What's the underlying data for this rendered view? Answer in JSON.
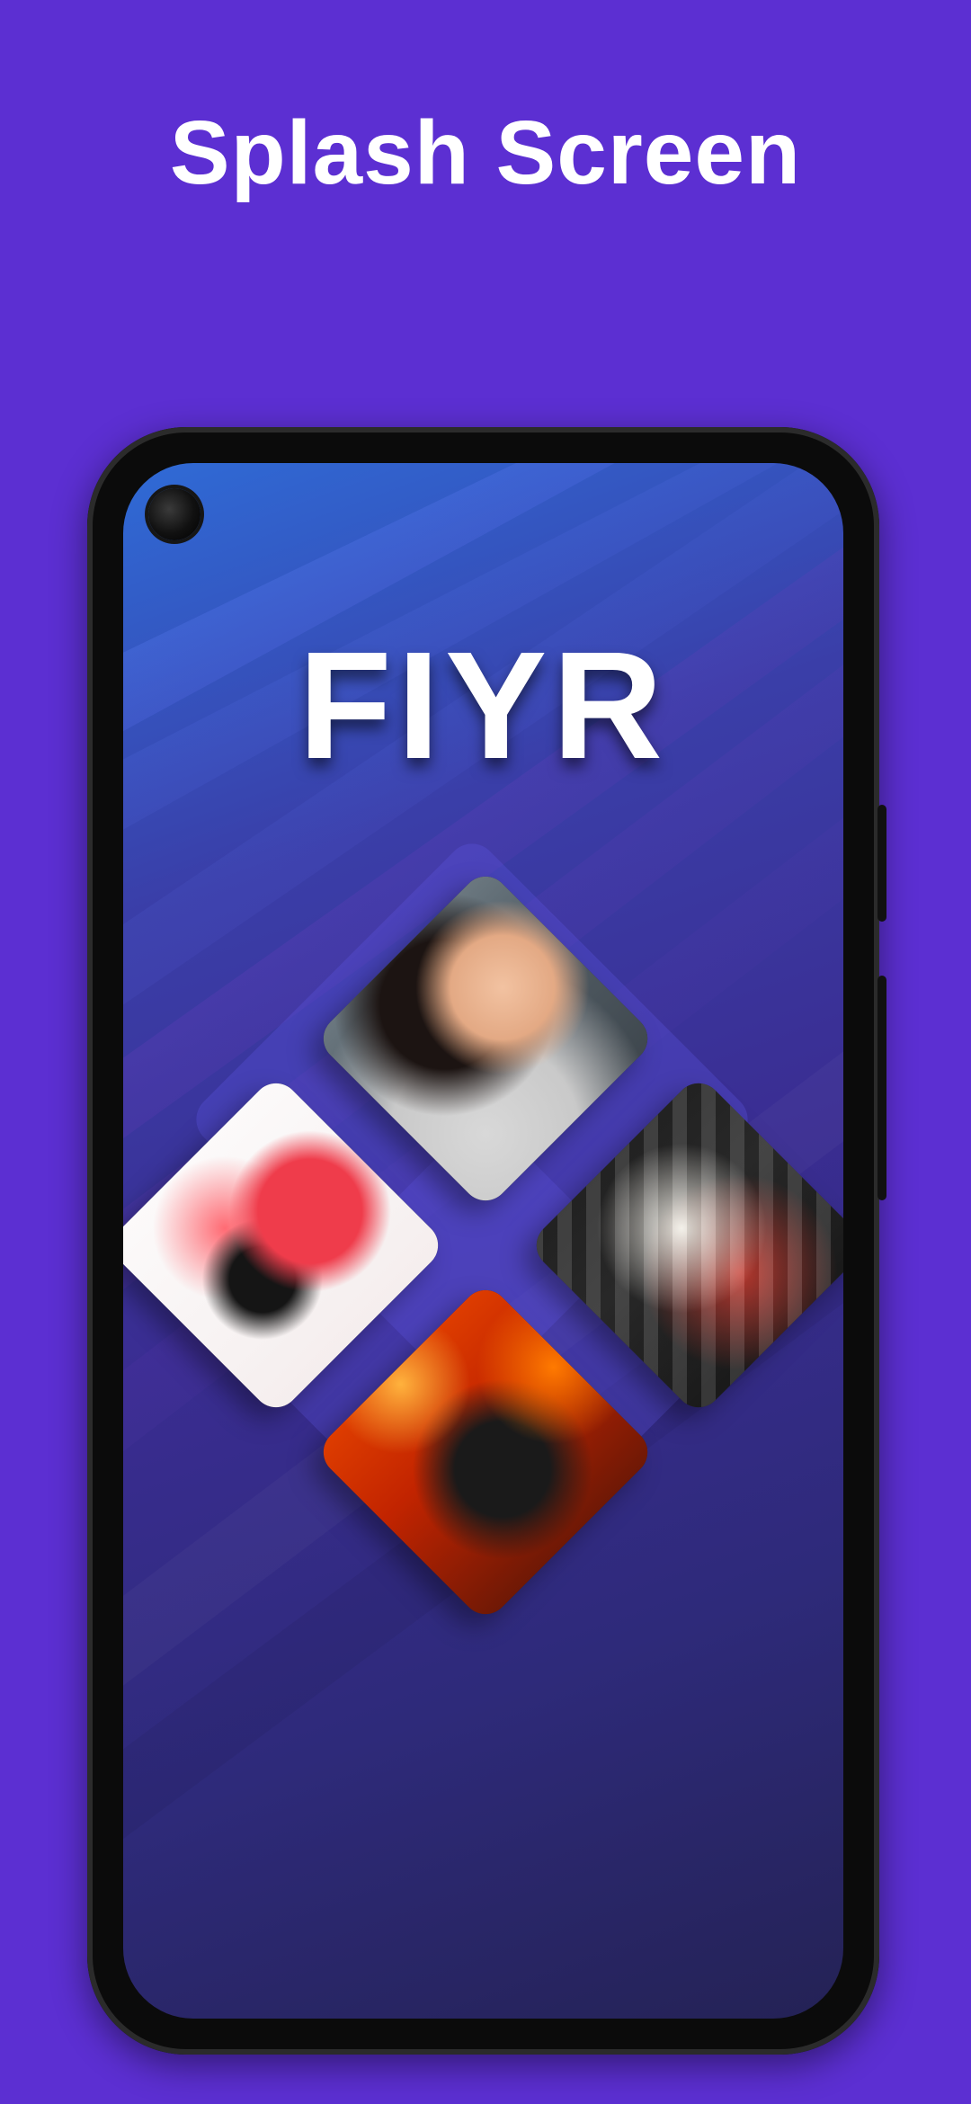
{
  "header": {
    "title": "Splash Screen"
  },
  "app": {
    "logo_text": "FIYR"
  },
  "collage": {
    "tiles": [
      {
        "name": "portrait-photo",
        "icon": "portrait-image-icon"
      },
      {
        "name": "idea-illustration",
        "icon": "lightbulb-illustration-icon"
      },
      {
        "name": "posters-photo",
        "icon": "posters-image-icon"
      },
      {
        "name": "camera-photo",
        "icon": "camera-image-icon"
      }
    ]
  },
  "colors": {
    "page_background": "#5c2fd2",
    "screen_gradient_top": "#2f6bd6",
    "screen_gradient_bottom": "#242255",
    "text": "#ffffff"
  }
}
